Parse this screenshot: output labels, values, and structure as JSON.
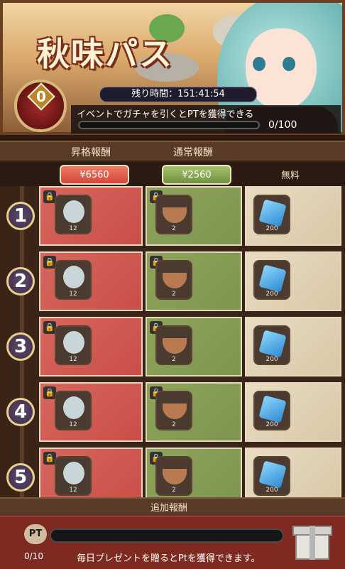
{
  "banner": {
    "title": "秋味パス",
    "timer": "残り時間：151:41:54",
    "pt_level": "0",
    "mission_text": "イベントでガチャを引くとPTを獲得できる",
    "progress_text": "0/100",
    "progress_fraction": 0
  },
  "tiers": {
    "premium_label": "昇格報酬",
    "normal_label": "通常報酬",
    "premium_price": "¥6560",
    "normal_price": "¥2560",
    "free_label": "無料"
  },
  "rows": [
    {
      "level": "1",
      "premium_qty": "12",
      "normal_qty": "2",
      "free_qty": "200"
    },
    {
      "level": "2",
      "premium_qty": "12",
      "normal_qty": "2",
      "free_qty": "200"
    },
    {
      "level": "3",
      "premium_qty": "12",
      "normal_qty": "2",
      "free_qty": "200"
    },
    {
      "level": "4",
      "premium_qty": "12",
      "normal_qty": "2",
      "free_qty": "200"
    },
    {
      "level": "5",
      "premium_qty": "12",
      "normal_qty": "2",
      "free_qty": "200"
    }
  ],
  "bonus": {
    "header": "追加報酬",
    "pt_label": "PT",
    "count": "0/10",
    "desc": "毎日プレゼントを贈るとPtを獲得できます。",
    "progress_fraction": 0
  },
  "icons": {
    "lock": "lock-icon",
    "premium_item": "character-portrait-icon",
    "normal_item": "soup-bowl-icon",
    "free_item": "blue-gem-icon",
    "gift": "gift-box-icon"
  },
  "colors": {
    "premium": "#d7665d",
    "normal": "#8ea45a",
    "free": "#e8dcc3",
    "bottom_panel": "#7e2a20"
  }
}
